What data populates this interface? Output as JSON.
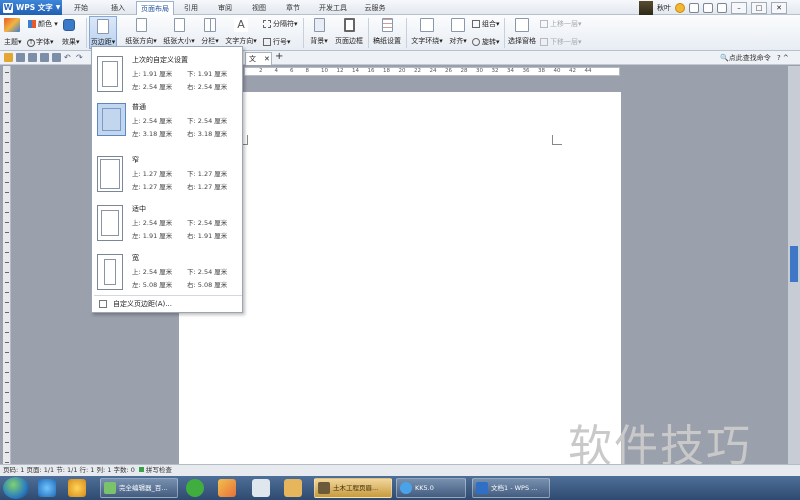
{
  "app": {
    "name": "WPS 文字"
  },
  "menu_tabs": [
    "开始",
    "插入",
    "页面布局",
    "引用",
    "审阅",
    "视图",
    "章节",
    "开发工具",
    "云服务"
  ],
  "active_tab": "页面布局",
  "user": {
    "name": "秋叶"
  },
  "ribbon": {
    "theme": "主题",
    "colors": "颜色",
    "fonts": "字体",
    "effects": "效果",
    "margins": "页边距",
    "orientation": "纸张方向",
    "size": "纸张大小",
    "columns": "分栏",
    "text_direction": "文字方向",
    "breaks": "分隔符",
    "line_numbers": "行号",
    "background": "背景",
    "page_border": "页面边框",
    "paper_setup": "稿纸设置",
    "wrap_text": "文字环绕",
    "align": "对齐",
    "rotate": "旋转",
    "group": "组合",
    "selection_pane": "选择窗格",
    "bring_forward": "上移一层",
    "send_backward": "下移一层"
  },
  "doc_tab": "文",
  "search_label": "点此查找命令",
  "ruler_numbers": [
    "2",
    "4",
    "6",
    "8",
    "10",
    "12",
    "14",
    "16",
    "18",
    "20",
    "22",
    "24",
    "26",
    "28",
    "30",
    "32",
    "34",
    "36",
    "38",
    "40",
    "42",
    "44"
  ],
  "margins_menu": {
    "items": [
      {
        "title": "上次的自定义设置",
        "top": "上: 1.91 厘米",
        "bottom": "下: 1.91 厘米",
        "left": "左: 2.54 厘米",
        "right": "右: 2.54 厘米"
      },
      {
        "title": "普通",
        "top": "上: 2.54 厘米",
        "bottom": "下: 2.54 厘米",
        "left": "左: 3.18 厘米",
        "right": "右: 3.18 厘米"
      },
      {
        "title": "窄",
        "top": "上: 1.27 厘米",
        "bottom": "下: 1.27 厘米",
        "left": "左: 1.27 厘米",
        "right": "右: 1.27 厘米"
      },
      {
        "title": "适中",
        "top": "上: 2.54 厘米",
        "bottom": "下: 2.54 厘米",
        "left": "左: 1.91 厘米",
        "right": "右: 1.91 厘米"
      },
      {
        "title": "宽",
        "top": "上: 2.54 厘米",
        "bottom": "下: 2.54 厘米",
        "left": "左: 5.08 厘米",
        "right": "右: 5.08 厘米"
      }
    ],
    "custom": "自定义页边距(A)..."
  },
  "status": {
    "text": "页码: 1  页面: 1/1  节: 1/1  行: 1  列: 1  字数: 0",
    "spell": "拼写检查"
  },
  "taskbar": {
    "buttons": [
      "完全编辑器_百...",
      "土木工程页眉...",
      "KK5.0",
      "文档1 - WPS ..."
    ]
  },
  "watermark": "软件技巧"
}
